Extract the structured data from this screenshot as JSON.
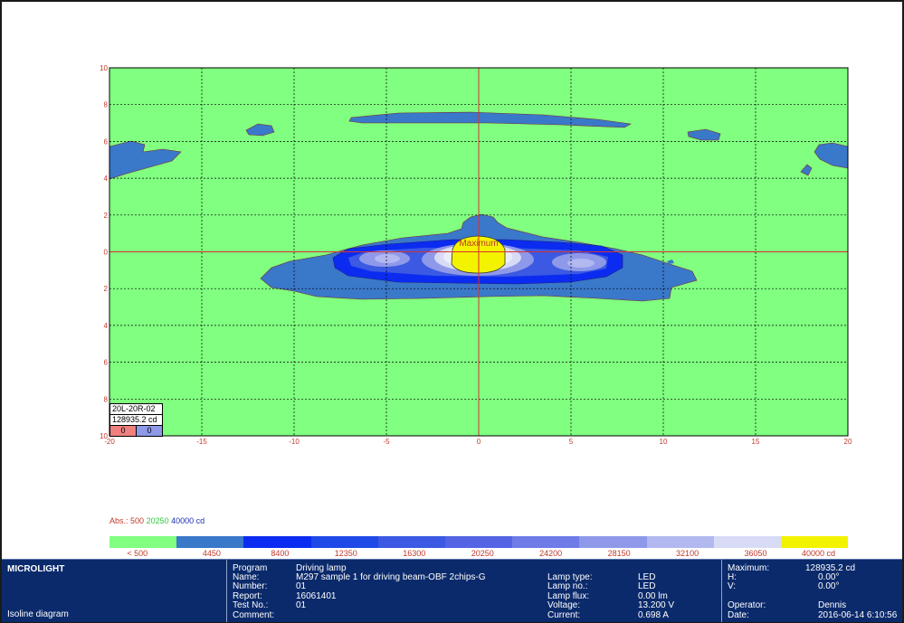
{
  "colors": {
    "background": "#80ff80",
    "band_1": "#3a78c9",
    "band_2": "#0b2cf0",
    "band_3": "#1f4ae8",
    "band_4": "#3b59e2",
    "band_5": "#5464e5",
    "band_6": "#6f7be7",
    "band_7": "#8f99ea",
    "band_8": "#b2b8f0",
    "band_9": "#d8dbf6",
    "band_10": "#ecedfb",
    "max": "#f3f300",
    "grid": "#000000",
    "axis": "#d93030",
    "panel": "#0b2a6b"
  },
  "chart_data": {
    "type": "heatmap",
    "title": "",
    "xlabel": "",
    "ylabel": "",
    "xlim": [
      -20,
      20
    ],
    "ylim": [
      -10,
      10
    ],
    "x_ticks": [
      "-20",
      "-15",
      "-10",
      "-5",
      "0",
      "5",
      "10",
      "15",
      "20"
    ],
    "y_ticks": [
      "10",
      "8",
      "6",
      "4",
      "2",
      "0",
      "2",
      "4",
      "6",
      "8",
      "10"
    ],
    "grid": true,
    "max_label": "Maximum",
    "levels_cd": [
      500,
      4450,
      8400,
      12350,
      16300,
      20250,
      24200,
      28150,
      32100,
      36050,
      40000
    ],
    "scale_labels": [
      "< 500",
      "4450",
      "8400",
      "12350",
      "16300",
      "20250",
      "24200",
      "28150",
      "32100",
      "36050",
      "40000 cd"
    ],
    "abs_legend": {
      "prefix": "Abs.: ",
      "v1": "500",
      "v2": "20250",
      "v3": "40000",
      "unit": " cd",
      "c1": "#c0392b",
      "c2": "#2ecc40",
      "c3": "#1f2fb0"
    }
  },
  "info_box": {
    "name": "20L-20R-02",
    "value": "128935.2 cd",
    "count_red": "0",
    "count_blue": "0"
  },
  "panel": {
    "title": "MICROLIGHT",
    "subtitle": "Isoline diagram",
    "fields": [
      {
        "label": "Program",
        "value": "Driving lamp"
      },
      {
        "label": "Name:",
        "value": "M297 sample 1 for driving beam-OBF 2chips-G"
      },
      {
        "label": "Number:",
        "value": "01"
      },
      {
        "label": "Report:",
        "value": "16061401"
      },
      {
        "label": "Test No.:",
        "value": "01"
      },
      {
        "label": "Comment:",
        "value": ""
      }
    ],
    "lamp": [
      {
        "label": "Lamp type:",
        "value": "LED"
      },
      {
        "label": "Lamp no.:",
        "value": "LED"
      },
      {
        "label": "Lamp flux:",
        "value": "0.00 lm"
      },
      {
        "label": "Voltage:",
        "value": "13.200 V"
      },
      {
        "label": "Current:",
        "value": "0.698 A"
      }
    ],
    "max": [
      {
        "label": "Maximum:",
        "value": "128935.2 cd"
      },
      {
        "label": "H:",
        "value": "0.00°"
      },
      {
        "label": "V:",
        "value": "0.00°"
      }
    ],
    "operator": {
      "label": "Operator:",
      "value": "Dennis"
    },
    "date": {
      "label": "Date:",
      "value": "2016-06-14 6:10:56"
    }
  }
}
